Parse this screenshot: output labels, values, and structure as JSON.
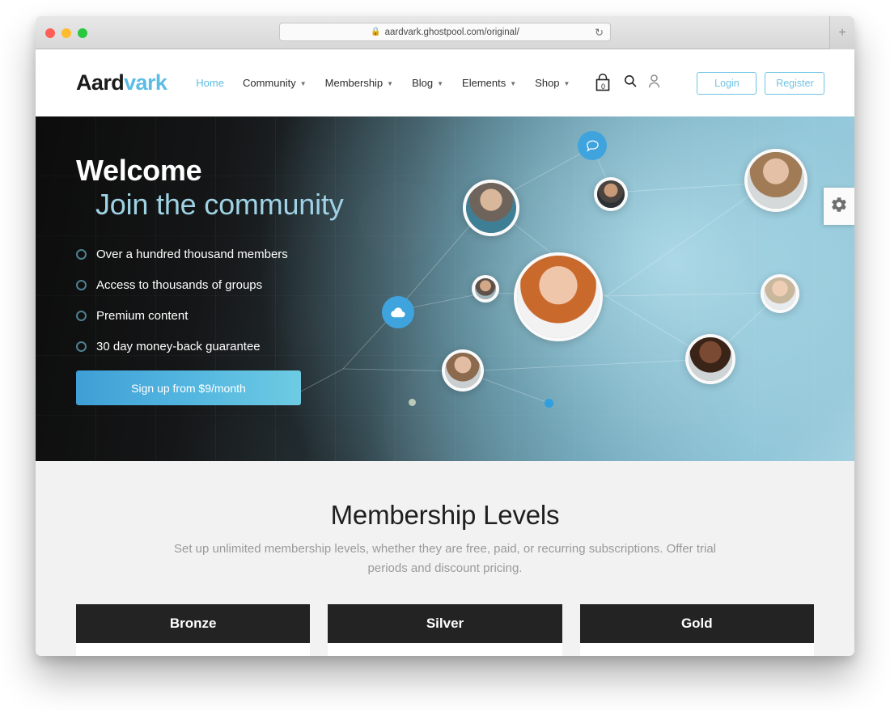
{
  "browser": {
    "url": "aardvark.ghostpool.com/original/",
    "lock_icon": "lock-icon",
    "reload_icon": "reload-icon",
    "newtab_label": "+",
    "traffic_lights": [
      "close",
      "minimize",
      "maximize"
    ]
  },
  "header": {
    "logo_dark": "Aard",
    "logo_light": "vark",
    "nav": [
      {
        "label": "Home",
        "active": true,
        "caret": false
      },
      {
        "label": "Community",
        "active": false,
        "caret": true
      },
      {
        "label": "Membership",
        "active": false,
        "caret": true
      },
      {
        "label": "Blog",
        "active": false,
        "caret": true
      },
      {
        "label": "Elements",
        "active": false,
        "caret": true
      },
      {
        "label": "Shop",
        "active": false,
        "caret": true
      }
    ],
    "cart_count": "0",
    "cart_icon": "shopping-bag-icon",
    "search_icon": "search-icon",
    "account_icon": "user-icon",
    "login_label": "Login",
    "register_label": "Register",
    "accent_color": "#6fc4e4"
  },
  "hero": {
    "title_line1": "Welcome",
    "title_line2": "Join the community",
    "features": [
      "Over a hundred thousand members",
      "Access to thousands of groups",
      "Premium content",
      "30 day money-back guarantee"
    ],
    "cta_label": "Sign up from $9/month",
    "cta_gradient_from": "#3f9fd6",
    "cta_gradient_to": "#6ecbe3",
    "title_accent_color": "#9ed2e4",
    "bullet_color": "#4e818f",
    "chat_icon": "chat-bubble-icon",
    "cloud_icon": "cloud-icon",
    "gear_icon": "gear-icon"
  },
  "membership": {
    "title": "Membership Levels",
    "subtitle": "Set up unlimited membership levels, whether they are free, paid, or recurring subscriptions. Offer trial periods and discount pricing.",
    "plans": [
      {
        "name": "Bronze"
      },
      {
        "name": "Silver"
      },
      {
        "name": "Gold"
      }
    ],
    "header_color": "#232323",
    "section_bg": "#f2f2f2"
  }
}
